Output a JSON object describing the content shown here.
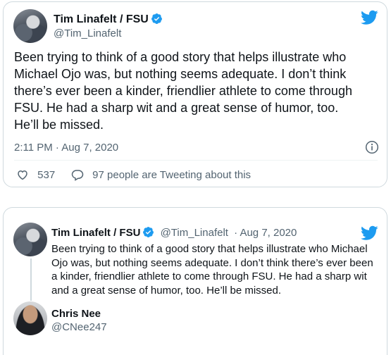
{
  "tweet1": {
    "author_name": "Tim Linafelt / FSU",
    "author_handle": "@Tim_Linafelt",
    "text": "Been trying to think of a good story that helps illustrate who\nMichael Ojo was, but nothing seems adequate. I don’t think\nthere’s ever been a kinder, friendlier athlete to come through\nFSU. He had a sharp wit and a great sense of humor, too.\nHe’ll be missed.",
    "timestamp": "2:11 PM · Aug 7, 2020",
    "likes": "537",
    "tweeting_text": "97 people are Tweeting about this"
  },
  "tweet2": {
    "author_name": "Tim Linafelt / FSU",
    "author_handle": "@Tim_Linafelt",
    "date": "· Aug 7, 2020",
    "text": "Been trying to think of a good story that helps illustrate who Michael\nOjo was, but nothing seems adequate. I don’t think there’s ever been\na kinder, friendlier athlete to come through FSU. He had a sharp wit\nand a great sense of humor, too. He’ll be missed.",
    "reply_author_name": "Chris Nee",
    "reply_author_handle": "@CNee247"
  },
  "colors": {
    "brand_blue": "#1d9bf0",
    "text_primary": "#0f1419",
    "text_secondary": "#536471",
    "border": "#cfd9de"
  },
  "icons": [
    "twitter-bird-icon",
    "verified-badge-icon",
    "info-icon",
    "heart-icon",
    "comment-bubble-icon"
  ]
}
